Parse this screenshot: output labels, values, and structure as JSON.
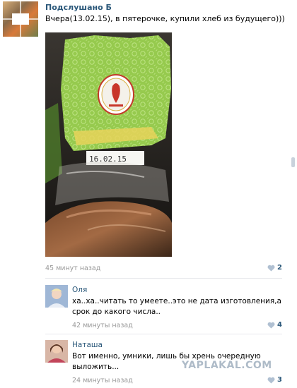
{
  "post": {
    "avatar_caption": "",
    "author": "Подслушано Б",
    "text": "Вчера(13.02.15), в пятерочке, купили хлеб из будущего)))",
    "photo": {
      "label_date": "16.02.15"
    },
    "time": "45 минут назад",
    "likes": "2"
  },
  "comments": [
    {
      "name": "Оля",
      "text": "ха..ха..читать то умеете..это не дата изготовления,а срок до какого числа..",
      "time": "42 минуты назад",
      "likes": "4"
    },
    {
      "name": "Наташа",
      "text": "Вот именно, умники, лишь бы хрень очередную выложить...",
      "time": "24 минуты назад",
      "likes": "3"
    }
  ],
  "watermark": "YAPLAKAL.COM",
  "colors": {
    "link": "#2b587a",
    "muted": "#999999",
    "divider": "#e7e8ec",
    "heart": "#b0c0d2",
    "package_green": "#8cc83c"
  }
}
